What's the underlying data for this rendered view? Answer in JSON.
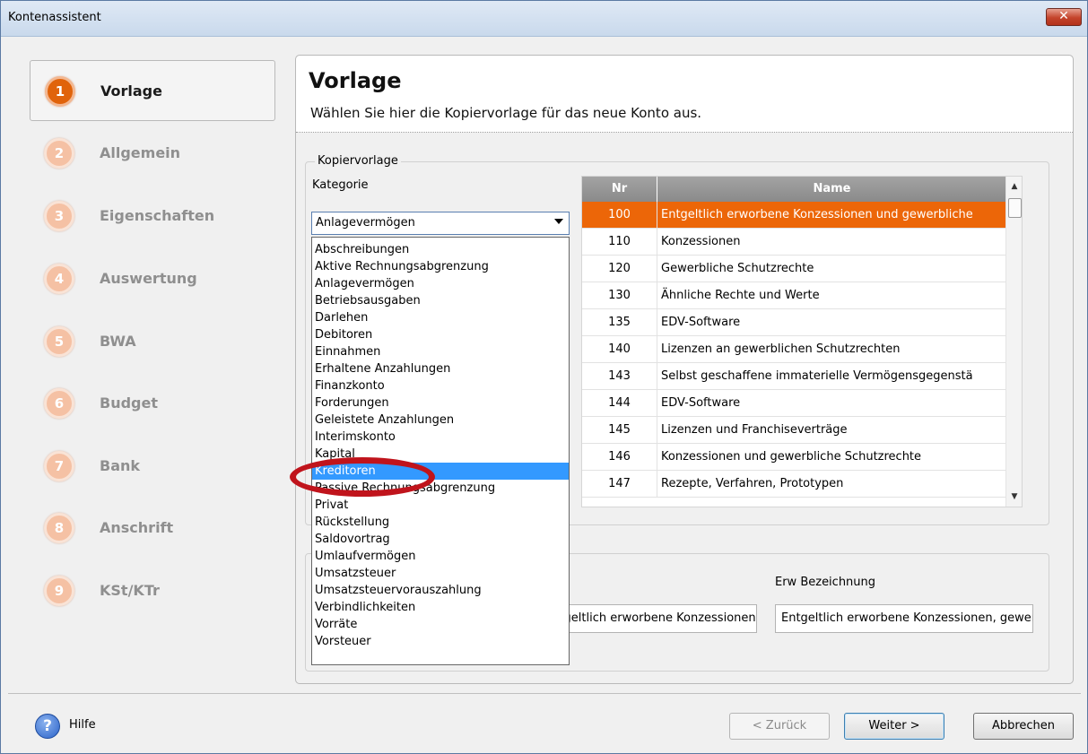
{
  "window": {
    "title": "Kontenassistent",
    "close_label": "✕"
  },
  "steps": [
    {
      "num": "1",
      "label": "Vorlage"
    },
    {
      "num": "2",
      "label": "Allgemein"
    },
    {
      "num": "3",
      "label": "Eigenschaften"
    },
    {
      "num": "4",
      "label": "Auswertung"
    },
    {
      "num": "5",
      "label": "BWA"
    },
    {
      "num": "6",
      "label": "Budget"
    },
    {
      "num": "7",
      "label": "Bank"
    },
    {
      "num": "8",
      "label": "Anschrift"
    },
    {
      "num": "9",
      "label": "KSt/KTr"
    }
  ],
  "header": {
    "title": "Vorlage",
    "subtitle": "Wählen Sie hier die Kopiervorlage für das neue Konto aus."
  },
  "kopiervorlage": {
    "group_title": "Kopiervorlage",
    "kategorie_label": "Kategorie",
    "kategorie_value": "Anlagevermögen",
    "options": [
      "Abschreibungen",
      "Aktive Rechnungsabgrenzung",
      "Anlagevermögen",
      "Betriebsausgaben",
      "Darlehen",
      "Debitoren",
      "Einnahmen",
      "Erhaltene Anzahlungen",
      "Finanzkonto",
      "Forderungen",
      "Geleistete Anzahlungen",
      "Interimskonto",
      "Kapital",
      "Kreditoren",
      "Passive Rechnungsabgrenzung",
      "Privat",
      "Rückstellung",
      "Saldovortrag",
      "Umlaufvermögen",
      "Umsatzsteuer",
      "Umsatzsteuervorauszahlung",
      "Verbindlichkeiten",
      "Vorräte",
      "Vorsteuer"
    ],
    "highlighted_option": "Kreditoren"
  },
  "table": {
    "headers": {
      "nr": "Nr",
      "name": "Name"
    },
    "rows": [
      {
        "nr": "100",
        "name": "Entgeltlich erworbene Konzessionen und gewerbliche"
      },
      {
        "nr": "110",
        "name": "Konzessionen"
      },
      {
        "nr": "120",
        "name": "Gewerbliche Schutzrechte"
      },
      {
        "nr": "130",
        "name": "Ähnliche Rechte und Werte"
      },
      {
        "nr": "135",
        "name": "EDV-Software"
      },
      {
        "nr": "140",
        "name": "Lizenzen an gewerblichen Schutzrechten"
      },
      {
        "nr": "143",
        "name": "Selbst geschaffene immaterielle Vermögensgegenstä"
      },
      {
        "nr": "144",
        "name": "EDV-Software"
      },
      {
        "nr": "145",
        "name": "Lizenzen und Franchiseverträge"
      },
      {
        "nr": "146",
        "name": "Konzessionen und gewerbliche Schutzrechte"
      },
      {
        "nr": "147",
        "name": "Rezepte, Verfahren, Prototypen"
      }
    ]
  },
  "details": {
    "bezeichnung_label_tail": "e",
    "bezeichnung_value": "Entgeltlich erworbene Konzessionen u",
    "erw_label": "Erw Bezeichnung",
    "erw_value": "Entgeltlich erworbene Konzessionen, gewerbliche Schutzrechte"
  },
  "footer": {
    "help_label": "Hilfe",
    "back_label": "< Zurück",
    "next_label": "Weiter >",
    "cancel_label": "Abbrechen"
  },
  "colors": {
    "accent": "#ec6608",
    "highlight": "#3399ff",
    "annotation": "#c0141c"
  }
}
